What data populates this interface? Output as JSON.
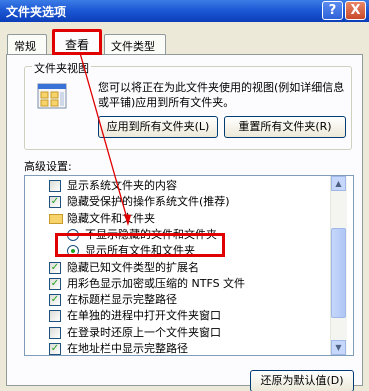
{
  "window": {
    "title": "文件夹选项",
    "help_glyph": "?",
    "close_glyph": "X"
  },
  "tabs": [
    {
      "label": "常规"
    },
    {
      "label": "查看",
      "active": true
    },
    {
      "label": "文件类型"
    }
  ],
  "folder_views": {
    "legend": "文件夹视图",
    "description": "您可以将正在为此文件夹使用的视图(例如详细信息或平铺)应用到所有文件夹。",
    "apply_all": "应用到所有文件夹(L)",
    "reset_all": "重置所有文件夹(R)"
  },
  "advanced": {
    "label": "高级设置:",
    "items": [
      {
        "type": "checkbox",
        "checked": false,
        "indent": 1,
        "label": "显示系统文件夹的内容"
      },
      {
        "type": "checkbox",
        "checked": true,
        "indent": 1,
        "label": "隐藏受保护的操作系统文件(推荐)"
      },
      {
        "type": "folder",
        "indent": 1,
        "label": "隐藏文件和文件夹"
      },
      {
        "type": "radio",
        "selected": false,
        "indent": 2,
        "label": "不显示隐藏的文件和文件夹"
      },
      {
        "type": "radio",
        "selected": true,
        "indent": 2,
        "label": "显示所有文件和文件夹"
      },
      {
        "type": "checkbox",
        "checked": true,
        "indent": 1,
        "label": "隐藏已知文件类型的扩展名"
      },
      {
        "type": "checkbox",
        "checked": true,
        "indent": 1,
        "label": "用彩色显示加密或压缩的 NTFS 文件"
      },
      {
        "type": "checkbox",
        "checked": true,
        "indent": 1,
        "label": "在标题栏显示完整路径"
      },
      {
        "type": "checkbox",
        "checked": false,
        "indent": 1,
        "label": "在单独的进程中打开文件夹窗口"
      },
      {
        "type": "checkbox",
        "checked": false,
        "indent": 1,
        "label": "在登录时还原上一个文件夹窗口"
      },
      {
        "type": "checkbox",
        "checked": true,
        "indent": 1,
        "label": "在地址栏中显示完整路径"
      }
    ]
  },
  "restore_defaults": "还原为默认值(D)",
  "colors": {
    "annotation_red": "#e00000",
    "title_blue": "#1e59d6",
    "check_green": "#21a121"
  }
}
